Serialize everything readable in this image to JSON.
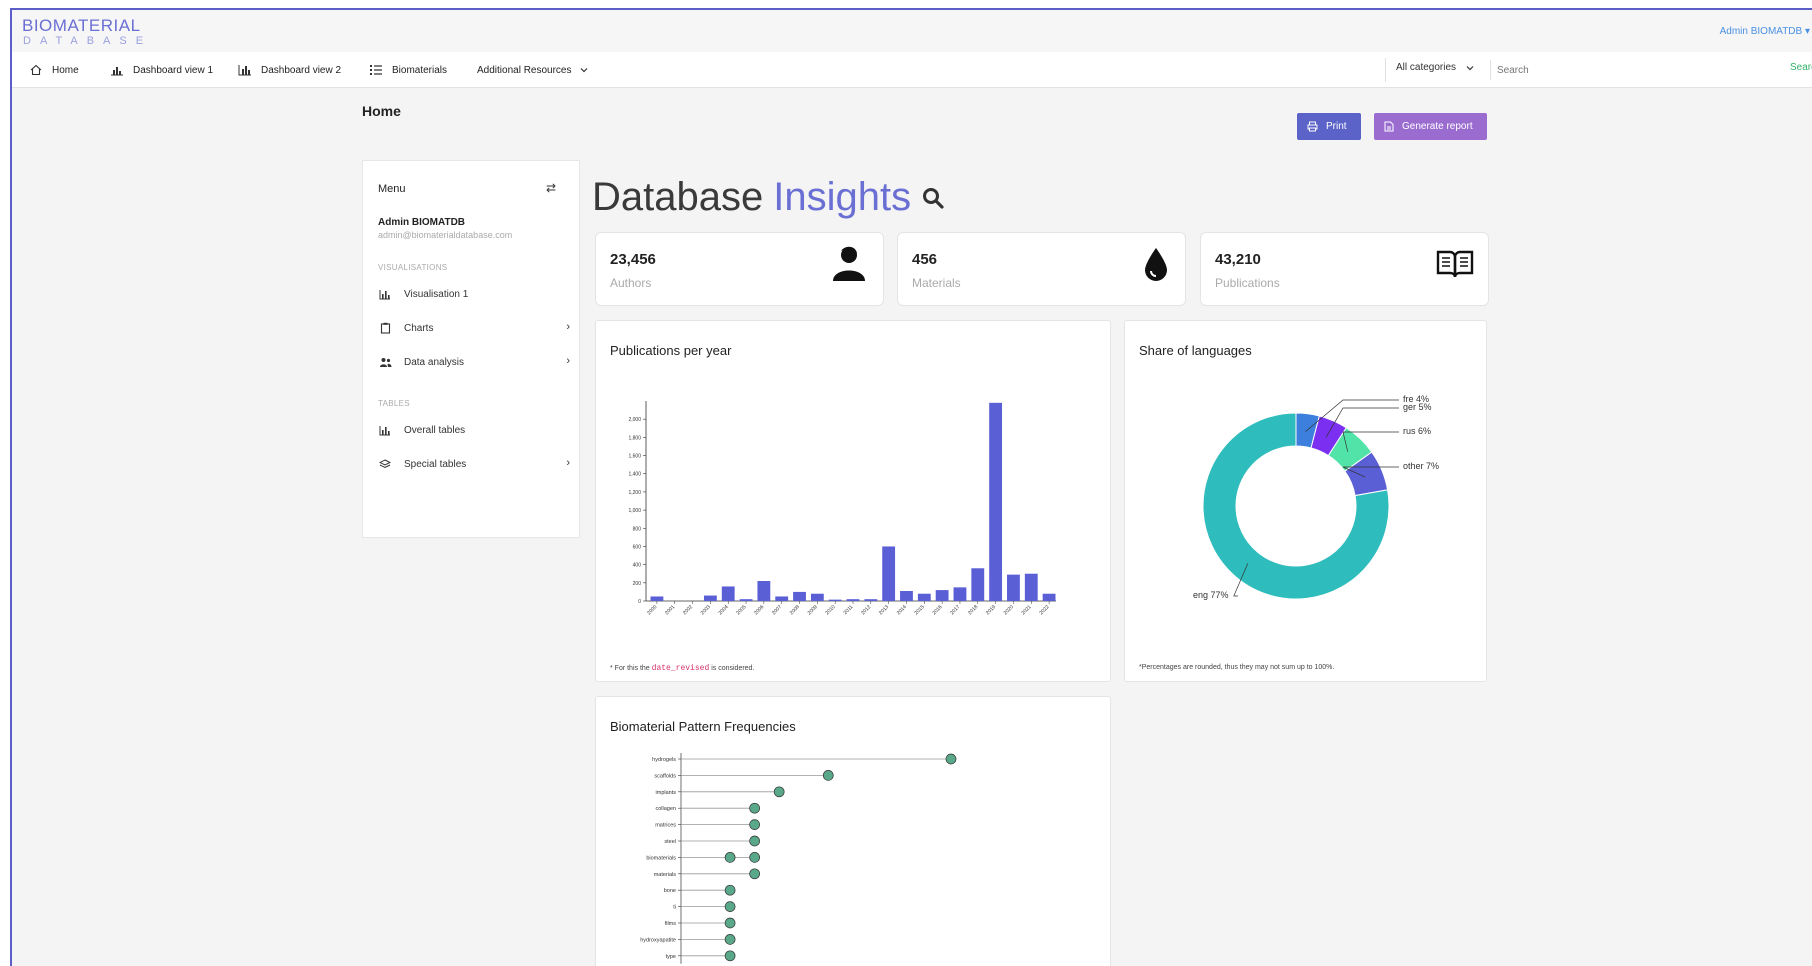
{
  "brand": {
    "line1": "BIOMATERIAL",
    "line2": "DATABASE"
  },
  "top_user": "Admin BIOMATDB ▾",
  "nav": {
    "home": "Home",
    "dash1": "Dashboard view 1",
    "dash2": "Dashboard view 2",
    "biomaterials": "Biomaterials",
    "resources": "Additional Resources"
  },
  "search": {
    "category": "All categories",
    "placeholder": "Search",
    "button": "Search"
  },
  "page": {
    "title": "Home",
    "print": "Print",
    "report": "Generate report"
  },
  "sidebar": {
    "menu": "Menu",
    "user": "Admin BIOMATDB",
    "email": "admin@biomaterialdatabase.com",
    "section_vis": "VISUALISATIONS",
    "section_tables": "TABLES",
    "items": [
      {
        "label": "Visualisation 1"
      },
      {
        "label": "Charts"
      },
      {
        "label": "Data analysis"
      },
      {
        "label": "Overall tables"
      },
      {
        "label": "Special tables"
      }
    ]
  },
  "insights": {
    "title_a": "Database",
    "title_b": "Insights"
  },
  "stats": [
    {
      "value": "23,456",
      "label": "Authors"
    },
    {
      "value": "456",
      "label": "Materials"
    },
    {
      "value": "43,210",
      "label": "Publications"
    }
  ],
  "panels": {
    "pubs_title": "Publications per year",
    "pubs_note_pre": "* For this the",
    "pubs_note_code": "date_revised",
    "pubs_note_post": "is considered.",
    "lang_title": "Share of languages",
    "lang_note": "*Percentages are rounded, thus they may not sum up to 100%.",
    "freq_title": "Biomaterial Pattern Frequencies"
  },
  "colors": {
    "accent": "#6a6fd3",
    "bar": "#5b5fd6",
    "lollipop": "#5aa88a"
  },
  "chart_data": [
    {
      "type": "bar",
      "title": "Publications per year",
      "categories": [
        "2000",
        "2001",
        "2002",
        "2003",
        "2004",
        "2005",
        "2006",
        "2007",
        "2008",
        "2009",
        "2010",
        "2011",
        "2012",
        "2013",
        "2014",
        "2015",
        "2016",
        "2017",
        "2018",
        "2019",
        "2020",
        "2021",
        "2022"
      ],
      "values": [
        50,
        0,
        0,
        60,
        160,
        20,
        220,
        50,
        100,
        80,
        15,
        20,
        20,
        600,
        110,
        80,
        120,
        150,
        360,
        2180,
        290,
        300,
        80
      ],
      "y_ticks": [
        0,
        200,
        400,
        600,
        800,
        1000,
        1200,
        1400,
        1600,
        1800,
        2000
      ],
      "y_tick_labels": [
        "0",
        "200",
        "400",
        "600",
        "800",
        "1,000",
        "1,200",
        "1,400",
        "1,600",
        "1,800",
        "2,000"
      ],
      "ylim": [
        0,
        2200
      ]
    },
    {
      "type": "pie",
      "title": "Share of languages",
      "labels": [
        "eng",
        "other",
        "rus",
        "ger",
        "fre"
      ],
      "values": [
        77,
        7,
        6,
        5,
        4
      ],
      "label_text": [
        "eng 77%",
        "other 7%",
        "rus 6%",
        "ger 5%",
        "fre 4%"
      ],
      "colors": [
        "#2ebcbc",
        "#5a5fd6",
        "#52e3a8",
        "#7b2ff0",
        "#3d7fdc"
      ]
    },
    {
      "type": "scatter",
      "title": "Biomaterial Pattern Frequencies",
      "categories": [
        "hydrogels",
        "scaffolds",
        "implants",
        "collagen",
        "matrices",
        "steel",
        "biomaterials",
        "materials",
        "bone",
        "ti",
        "films",
        "hydroxyapatite",
        "type"
      ],
      "values": [
        11,
        6,
        4,
        3,
        3,
        3,
        3,
        3,
        2,
        2,
        2,
        2,
        2
      ],
      "extra_points": [
        {
          "category": "biomaterials",
          "value": 2
        }
      ],
      "xlim": [
        0,
        11
      ]
    }
  ]
}
